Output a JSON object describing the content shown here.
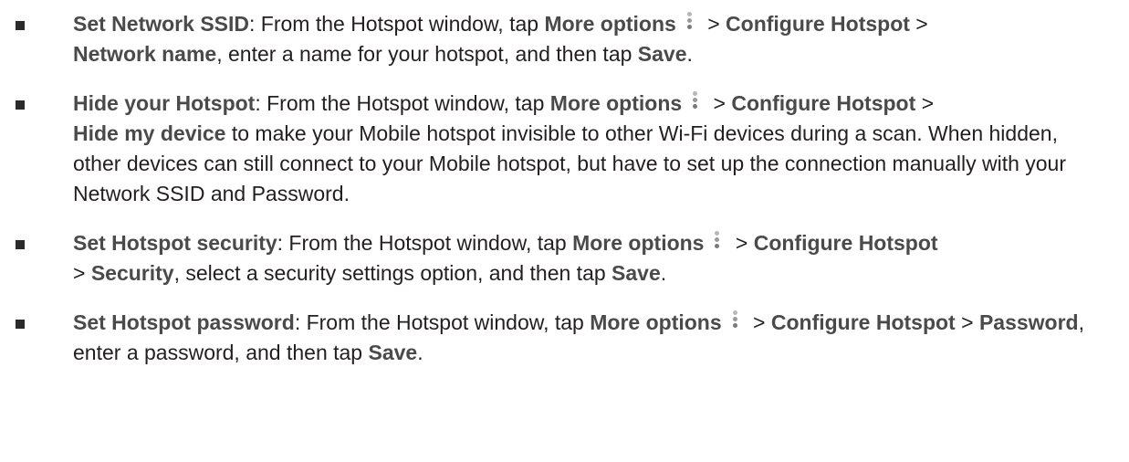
{
  "items": [
    {
      "title": "Set Network SSID",
      "t1": ": From the Hotspot window, tap ",
      "more_options": "More options",
      "t2": " > ",
      "configure": "Configure Hotspot",
      "t3": " >",
      "target": "Network name",
      "t4": ", enter a name for your hotspot, and then tap ",
      "save": "Save",
      "t5": "."
    },
    {
      "title": "Hide your Hotspot",
      "t1": ": From the Hotspot window, tap ",
      "more_options": "More options",
      "t2": " > ",
      "configure": "Configure Hotspot",
      "t3": " >",
      "target": "Hide my device",
      "t4": " to make your Mobile hotspot invisible to other Wi-Fi devices during a scan. When hidden, other devices can still connect to your Mobile hotspot, but have to set up the connection manually with your Network SSID and Password."
    },
    {
      "title": "Set Hotspot security",
      "t1": ": From the Hotspot window, tap ",
      "more_options": "More options",
      "t2": " > ",
      "configure": "Configure Hotspot",
      "t3": "> ",
      "target": "Security",
      "t4": ", select a security settings option, and then tap ",
      "save": "Save",
      "t5": "."
    },
    {
      "title": "Set Hotspot password",
      "t1": ": From the Hotspot window, tap ",
      "more_options": "More options",
      "t2": " > ",
      "configure": "Configure Hotspot",
      "t3": " > ",
      "target": "Password",
      "t4": ", enter a password, and then tap ",
      "save": "Save",
      "t5": "."
    }
  ],
  "icons": {
    "more_options": "more-options-vertical-dots-icon"
  }
}
